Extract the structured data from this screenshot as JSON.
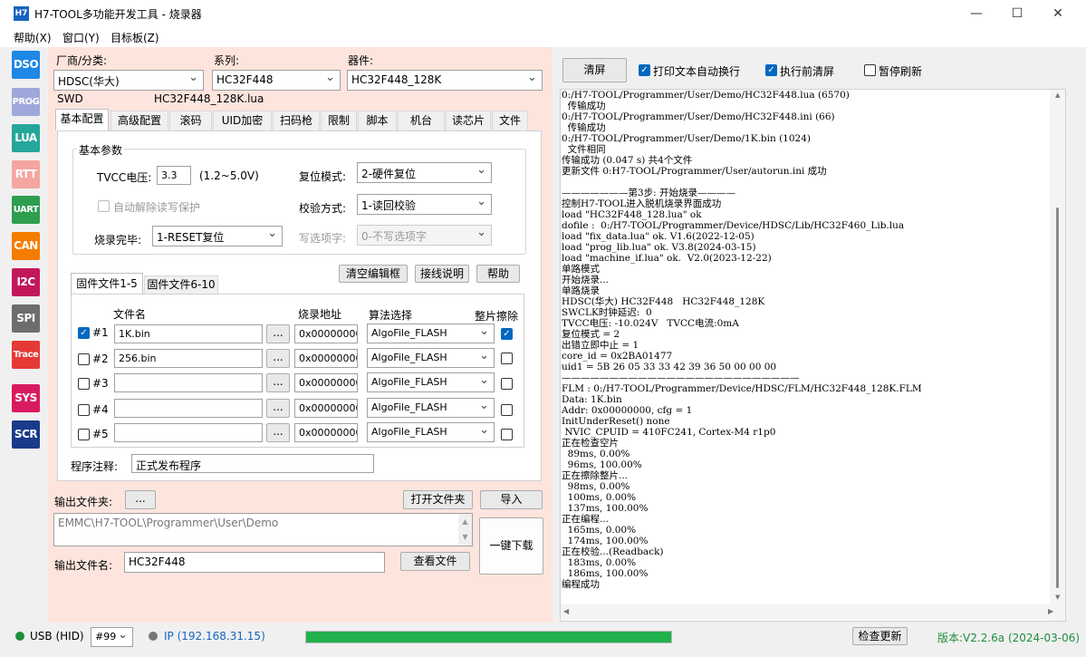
{
  "window": {
    "icon_text": "H7",
    "title": "H7-TOOL多功能开发工具 - 烧录器",
    "minimize": "—",
    "maximize": "☐",
    "close": "✕"
  },
  "menu": [
    "帮助(X)",
    "窗口(Y)",
    "目标板(Z)"
  ],
  "sidebar": [
    {
      "label": "DSO",
      "color": "#1e88e5"
    },
    {
      "label": "PROG",
      "color": "#9fa8da"
    },
    {
      "label": "LUA",
      "color": "#26a69a"
    },
    {
      "label": "RTT",
      "color": "#f4a6a0"
    },
    {
      "label": "UART",
      "color": "#2e9e4f"
    },
    {
      "label": "CAN",
      "color": "#f57c00"
    },
    {
      "label": "I2C",
      "color": "#c2185b"
    },
    {
      "label": "SPI",
      "color": "#6d6d6d"
    },
    {
      "label": "Trace",
      "color": "#e53935"
    },
    {
      "label": "SYS",
      "color": "#d81b60"
    },
    {
      "label": "SCR",
      "color": "#1a3a8a"
    }
  ],
  "config": {
    "vendor_label": "厂商/分类:",
    "vendor_value": "HDSC(华大)",
    "series_label": "系列:",
    "series_value": "HC32F448",
    "device_label": "器件:",
    "device_value": "HC32F448_128K",
    "interface": "SWD",
    "lua_file": "HC32F448_128K.lua"
  },
  "tabs": [
    "基本配置",
    "高级配置",
    "滚码",
    "UID加密",
    "扫码枪",
    "限制",
    "脚本",
    "机台",
    "读芯片",
    "文件"
  ],
  "basic": {
    "group_title": "基本参数",
    "tvcc_label": "TVCC电压:",
    "tvcc_value": "3.3",
    "tvcc_range": "(1.2~5.0V)",
    "reset_label": "复位模式:",
    "reset_value": "2-硬件复位",
    "auto_unprotect": "自动解除读写保护",
    "verify_label": "校验方式:",
    "verify_value": "1-读回校验",
    "after_label": "烧录完毕:",
    "after_value": "1-RESET复位",
    "option_label": "写选项字:",
    "option_value": "0-不写选项字"
  },
  "file_buttons": {
    "clear": "清空编辑框",
    "wiring": "接线说明",
    "help": "帮助"
  },
  "file_tabs": [
    "固件文件1-5",
    "固件文件6-10"
  ],
  "file_table": {
    "headers": {
      "name": "文件名",
      "addr": "烧录地址",
      "algo": "算法选择",
      "erase": "整片擦除"
    },
    "browse": "...",
    "rows": [
      {
        "id": "#1",
        "checked": true,
        "file": "1K.bin",
        "addr": "0x00000000",
        "algo": "AlgoFile_FLASH",
        "erase": true
      },
      {
        "id": "#2",
        "checked": false,
        "file": "256.bin",
        "addr": "0x00000000",
        "algo": "AlgoFile_FLASH",
        "erase": false
      },
      {
        "id": "#3",
        "checked": false,
        "file": "",
        "addr": "0x00000000",
        "algo": "AlgoFile_FLASH",
        "erase": false
      },
      {
        "id": "#4",
        "checked": false,
        "file": "",
        "addr": "0x00000000",
        "algo": "AlgoFile_FLASH",
        "erase": false
      },
      {
        "id": "#5",
        "checked": false,
        "file": "",
        "addr": "0x00000000",
        "algo": "AlgoFile_FLASH",
        "erase": false
      }
    ]
  },
  "note": {
    "label": "程序注释:",
    "value": "正式发布程序"
  },
  "output": {
    "folder_label": "输出文件夹:",
    "browse": "...",
    "open_folder": "打开文件夹",
    "import": "导入",
    "path": "EMMC\\H7-TOOL\\Programmer\\User\\Demo",
    "name_label": "输出文件名:",
    "name_value": "HC32F448",
    "view_file": "查看文件",
    "one_click": "一键下载"
  },
  "log_toolbar": {
    "clear": "清屏",
    "wrap": "打印文本自动换行",
    "wrap_checked": true,
    "clear_before": "执行前清屏",
    "clear_before_checked": true,
    "pause": "暂停刷新",
    "pause_checked": false
  },
  "log_lines": [
    "0:/H7-TOOL/Programmer/User/Demo/HC32F448.lua (6570)",
    "  传输成功",
    "0:/H7-TOOL/Programmer/User/Demo/HC32F448.ini (66)",
    "  传输成功",
    "0:/H7-TOOL/Programmer/User/Demo/1K.bin (1024)",
    "  文件相同",
    "传输成功 (0.047 s) 共4个文件",
    "更新文件 0:H7-TOOL/Programmer/User/autorun.ini 成功",
    "",
    "———————第3步: 开始烧录————",
    "控制H7-TOOL进入脱机烧录界面成功",
    "load \"HC32F448_128.lua\" ok",
    "dofile :  0:/H7-TOOL/Programmer/Device/HDSC/Lib/HC32F460_Lib.lua",
    "load \"fix_data.lua\" ok. V1.6(2022-12-05)",
    "load \"prog_lib.lua\" ok. V3.8(2024-03-15)",
    "load \"machine_if.lua\" ok.  V2.0(2023-12-22)",
    "单路模式",
    "开始烧录...",
    "单路烧录",
    "HDSC(华大) HC32F448   HC32F448_128K",
    "SWCLK时钟延迟:  0",
    "TVCC电压: -10.024V   TVCC电流:0mA",
    "复位模式 = 2",
    "出错立即中止 = 1",
    "core_id = 0x2BA01477",
    "uid1 = 5B 26 05 33 33 42 39 36 50 00 00 00",
    "—————————————————————————",
    "FLM : 0:/H7-TOOL/Programmer/Device/HDSC/FLM/HC32F448_128K.FLM",
    "Data: 1K.bin",
    "Addr: 0x00000000, cfg = 1",
    "InitUnderReset() none",
    " NVIC_CPUID = 410FC241, Cortex-M4 r1p0",
    "正在检查空片",
    "  89ms, 0.00%",
    "  96ms, 100.00%",
    "正在擦除整片...",
    "  98ms, 0.00%",
    "  100ms, 0.00%",
    "  137ms, 100.00%",
    "正在编程...",
    "  165ms, 0.00%",
    "  174ms, 100.00%",
    "正在校验...(Readback)",
    "  183ms, 0.00%",
    "  186ms, 100.00%",
    "编程成功"
  ],
  "status": {
    "usb": "USB (HID)",
    "usb_color": "#1e8e3e",
    "device_no": "#99",
    "ip": "IP (192.168.31.15)",
    "ip_color": "#1565c0",
    "progress_percent": 100,
    "progress_color": "#22b14c",
    "check_update": "检查更新",
    "version": "版本:V2.2.6a (2024-03-06)",
    "version_color": "#1e8e3e"
  }
}
